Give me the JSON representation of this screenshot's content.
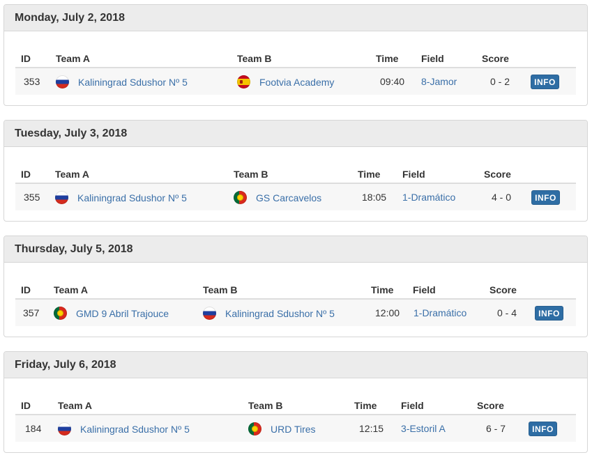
{
  "columns": {
    "id": "ID",
    "team_a": "Team A",
    "team_b": "Team B",
    "time": "Time",
    "field": "Field",
    "score": "Score"
  },
  "info_label": "INFO",
  "days": [
    {
      "date": "Monday, July 2, 2018",
      "match": {
        "id": "353",
        "team_a": {
          "name": "Kaliningrad Sdushor Nº 5",
          "flag": "russia-flag-icon"
        },
        "team_b": {
          "name": "Footvia Academy",
          "flag": "spain-flag-icon"
        },
        "time": "09:40",
        "field": "8-Jamor",
        "score": "0 - 2"
      }
    },
    {
      "date": "Tuesday, July 3, 2018",
      "match": {
        "id": "355",
        "team_a": {
          "name": "Kaliningrad Sdushor Nº 5",
          "flag": "russia-flag-icon"
        },
        "team_b": {
          "name": "GS Carcavelos",
          "flag": "portugal-flag-icon"
        },
        "time": "18:05",
        "field": "1-Dramático",
        "score": "4 - 0"
      }
    },
    {
      "date": "Thursday, July 5, 2018",
      "match": {
        "id": "357",
        "team_a": {
          "name": "GMD 9 Abril Trajouce",
          "flag": "portugal-flag-icon"
        },
        "team_b": {
          "name": "Kaliningrad Sdushor Nº 5",
          "flag": "russia-flag-icon"
        },
        "time": "12:00",
        "field": "1-Dramático",
        "score": "0 - 4"
      }
    },
    {
      "date": "Friday, July 6, 2018",
      "match": {
        "id": "184",
        "team_a": {
          "name": "Kaliningrad Sdushor Nº 5",
          "flag": "russia-flag-icon"
        },
        "team_b": {
          "name": "URD Tires",
          "flag": "portugal-flag-icon"
        },
        "time": "12:15",
        "field": "3-Estoril A",
        "score": "6 - 7"
      }
    }
  ]
}
